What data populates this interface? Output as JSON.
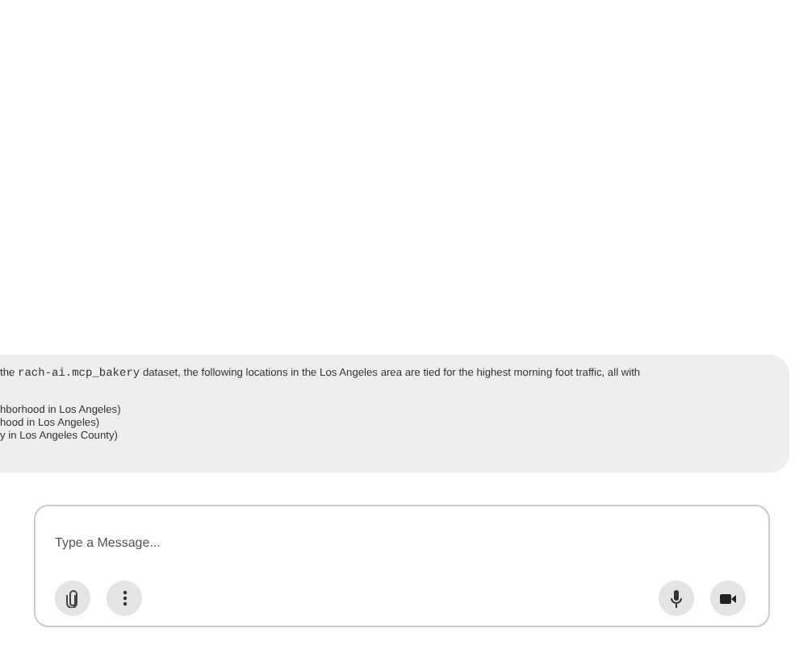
{
  "message": {
    "intro": [
      {
        "kind": "text",
        "text": "the "
      },
      {
        "kind": "code",
        "text": "rach-ai.mcp_bakery"
      },
      {
        "kind": "text",
        "text": " dataset, the following locations in the Los Angeles area are tied for the highest morning foot traffic, all with"
      }
    ],
    "items": [
      "hborhood in Los Angeles)",
      "hood in Los Angeles)",
      "y in Los Angeles County)"
    ]
  },
  "composer": {
    "placeholder": "Type a Message..."
  }
}
